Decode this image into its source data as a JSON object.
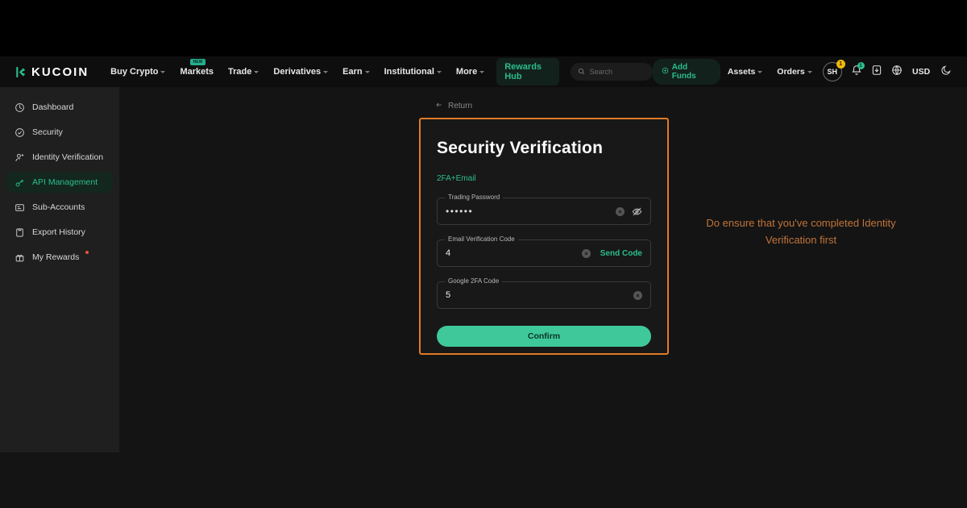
{
  "brand": {
    "name": "KUCOIN",
    "accent": "#2bbd8e",
    "annotation_color": "#c1743a",
    "card_border_color": "#e07b26"
  },
  "topnav": {
    "links": [
      {
        "label": "Buy Crypto",
        "caret": true,
        "badge": null
      },
      {
        "label": "Markets",
        "caret": false,
        "badge": "NEW"
      },
      {
        "label": "Trade",
        "caret": true,
        "badge": null
      },
      {
        "label": "Derivatives",
        "caret": true,
        "badge": null
      },
      {
        "label": "Earn",
        "caret": true,
        "badge": null
      },
      {
        "label": "Institutional",
        "caret": true,
        "badge": null
      },
      {
        "label": "More",
        "caret": true,
        "badge": null
      }
    ],
    "rewards_hub": "Rewards Hub",
    "search_placeholder": "Search",
    "add_funds": "Add Funds",
    "assets": "Assets",
    "orders": "Orders",
    "avatar_initials": "SH",
    "avatar_badge": "1",
    "bell_badge": "1",
    "currency": "USD"
  },
  "sidebar": {
    "items": [
      {
        "label": "Dashboard",
        "icon": "dashboard-icon",
        "active": false,
        "dot": false
      },
      {
        "label": "Security",
        "icon": "shield-check-icon",
        "active": false,
        "dot": false
      },
      {
        "label": "Identity Verification",
        "icon": "user-check-icon",
        "active": false,
        "dot": false
      },
      {
        "label": "API Management",
        "icon": "api-key-icon",
        "active": true,
        "dot": false
      },
      {
        "label": "Sub-Accounts",
        "icon": "sub-accounts-icon",
        "active": false,
        "dot": false
      },
      {
        "label": "Export History",
        "icon": "export-icon",
        "active": false,
        "dot": false
      },
      {
        "label": "My Rewards",
        "icon": "gift-icon",
        "active": false,
        "dot": true
      }
    ]
  },
  "main": {
    "return_label": "Return",
    "card": {
      "title": "Security Verification",
      "subtitle": "2FA+Email",
      "fields": [
        {
          "label": "Trading Password",
          "value": "••••••",
          "has_clear": true,
          "has_eye": true,
          "action": null
        },
        {
          "label": "Email Verification Code",
          "value": "4",
          "has_clear": true,
          "has_eye": false,
          "action": "Send Code"
        },
        {
          "label": "Google 2FA Code",
          "value": "5",
          "has_clear": true,
          "has_eye": false,
          "action": null
        }
      ],
      "confirm_label": "Confirm"
    },
    "annotation": "Do ensure that you've completed Identity Verification first"
  }
}
